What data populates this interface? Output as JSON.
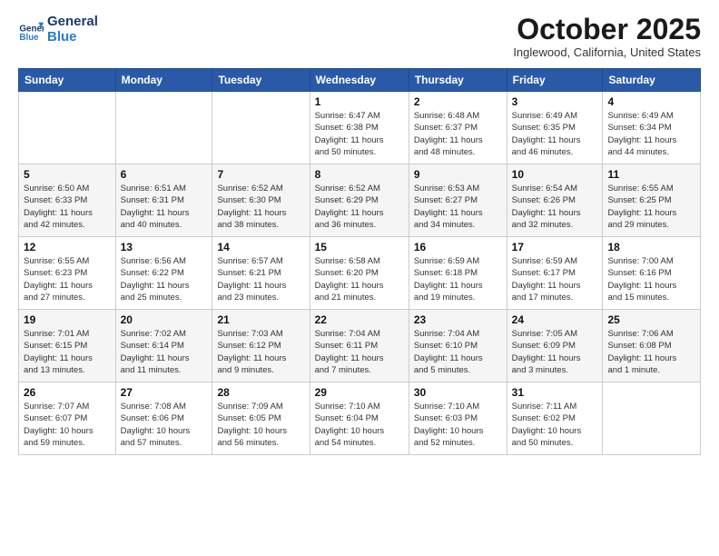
{
  "header": {
    "logo_line1": "General",
    "logo_line2": "Blue",
    "month": "October 2025",
    "location": "Inglewood, California, United States"
  },
  "weekdays": [
    "Sunday",
    "Monday",
    "Tuesday",
    "Wednesday",
    "Thursday",
    "Friday",
    "Saturday"
  ],
  "weeks": [
    [
      {
        "day": "",
        "info": ""
      },
      {
        "day": "",
        "info": ""
      },
      {
        "day": "",
        "info": ""
      },
      {
        "day": "1",
        "info": "Sunrise: 6:47 AM\nSunset: 6:38 PM\nDaylight: 11 hours\nand 50 minutes."
      },
      {
        "day": "2",
        "info": "Sunrise: 6:48 AM\nSunset: 6:37 PM\nDaylight: 11 hours\nand 48 minutes."
      },
      {
        "day": "3",
        "info": "Sunrise: 6:49 AM\nSunset: 6:35 PM\nDaylight: 11 hours\nand 46 minutes."
      },
      {
        "day": "4",
        "info": "Sunrise: 6:49 AM\nSunset: 6:34 PM\nDaylight: 11 hours\nand 44 minutes."
      }
    ],
    [
      {
        "day": "5",
        "info": "Sunrise: 6:50 AM\nSunset: 6:33 PM\nDaylight: 11 hours\nand 42 minutes."
      },
      {
        "day": "6",
        "info": "Sunrise: 6:51 AM\nSunset: 6:31 PM\nDaylight: 11 hours\nand 40 minutes."
      },
      {
        "day": "7",
        "info": "Sunrise: 6:52 AM\nSunset: 6:30 PM\nDaylight: 11 hours\nand 38 minutes."
      },
      {
        "day": "8",
        "info": "Sunrise: 6:52 AM\nSunset: 6:29 PM\nDaylight: 11 hours\nand 36 minutes."
      },
      {
        "day": "9",
        "info": "Sunrise: 6:53 AM\nSunset: 6:27 PM\nDaylight: 11 hours\nand 34 minutes."
      },
      {
        "day": "10",
        "info": "Sunrise: 6:54 AM\nSunset: 6:26 PM\nDaylight: 11 hours\nand 32 minutes."
      },
      {
        "day": "11",
        "info": "Sunrise: 6:55 AM\nSunset: 6:25 PM\nDaylight: 11 hours\nand 29 minutes."
      }
    ],
    [
      {
        "day": "12",
        "info": "Sunrise: 6:55 AM\nSunset: 6:23 PM\nDaylight: 11 hours\nand 27 minutes."
      },
      {
        "day": "13",
        "info": "Sunrise: 6:56 AM\nSunset: 6:22 PM\nDaylight: 11 hours\nand 25 minutes."
      },
      {
        "day": "14",
        "info": "Sunrise: 6:57 AM\nSunset: 6:21 PM\nDaylight: 11 hours\nand 23 minutes."
      },
      {
        "day": "15",
        "info": "Sunrise: 6:58 AM\nSunset: 6:20 PM\nDaylight: 11 hours\nand 21 minutes."
      },
      {
        "day": "16",
        "info": "Sunrise: 6:59 AM\nSunset: 6:18 PM\nDaylight: 11 hours\nand 19 minutes."
      },
      {
        "day": "17",
        "info": "Sunrise: 6:59 AM\nSunset: 6:17 PM\nDaylight: 11 hours\nand 17 minutes."
      },
      {
        "day": "18",
        "info": "Sunrise: 7:00 AM\nSunset: 6:16 PM\nDaylight: 11 hours\nand 15 minutes."
      }
    ],
    [
      {
        "day": "19",
        "info": "Sunrise: 7:01 AM\nSunset: 6:15 PM\nDaylight: 11 hours\nand 13 minutes."
      },
      {
        "day": "20",
        "info": "Sunrise: 7:02 AM\nSunset: 6:14 PM\nDaylight: 11 hours\nand 11 minutes."
      },
      {
        "day": "21",
        "info": "Sunrise: 7:03 AM\nSunset: 6:12 PM\nDaylight: 11 hours\nand 9 minutes."
      },
      {
        "day": "22",
        "info": "Sunrise: 7:04 AM\nSunset: 6:11 PM\nDaylight: 11 hours\nand 7 minutes."
      },
      {
        "day": "23",
        "info": "Sunrise: 7:04 AM\nSunset: 6:10 PM\nDaylight: 11 hours\nand 5 minutes."
      },
      {
        "day": "24",
        "info": "Sunrise: 7:05 AM\nSunset: 6:09 PM\nDaylight: 11 hours\nand 3 minutes."
      },
      {
        "day": "25",
        "info": "Sunrise: 7:06 AM\nSunset: 6:08 PM\nDaylight: 11 hours\nand 1 minute."
      }
    ],
    [
      {
        "day": "26",
        "info": "Sunrise: 7:07 AM\nSunset: 6:07 PM\nDaylight: 10 hours\nand 59 minutes."
      },
      {
        "day": "27",
        "info": "Sunrise: 7:08 AM\nSunset: 6:06 PM\nDaylight: 10 hours\nand 57 minutes."
      },
      {
        "day": "28",
        "info": "Sunrise: 7:09 AM\nSunset: 6:05 PM\nDaylight: 10 hours\nand 56 minutes."
      },
      {
        "day": "29",
        "info": "Sunrise: 7:10 AM\nSunset: 6:04 PM\nDaylight: 10 hours\nand 54 minutes."
      },
      {
        "day": "30",
        "info": "Sunrise: 7:10 AM\nSunset: 6:03 PM\nDaylight: 10 hours\nand 52 minutes."
      },
      {
        "day": "31",
        "info": "Sunrise: 7:11 AM\nSunset: 6:02 PM\nDaylight: 10 hours\nand 50 minutes."
      },
      {
        "day": "",
        "info": ""
      }
    ]
  ]
}
